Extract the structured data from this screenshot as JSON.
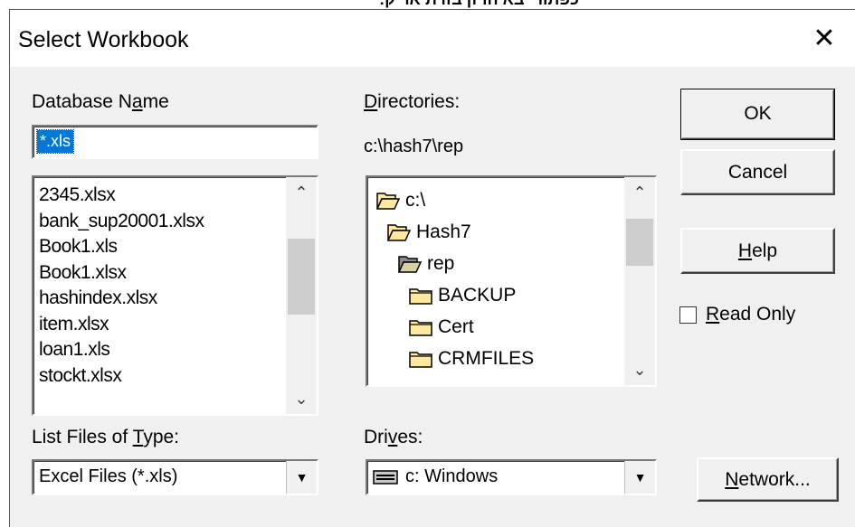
{
  "top_strip_text": "כפתור יבא הרזן בזרת אריק:",
  "dialog": {
    "title": "Select Workbook",
    "close_glyph": "✕"
  },
  "database_name": {
    "label_pre": "Database N",
    "label_u": "a",
    "label_post": "me",
    "value": "*.xls"
  },
  "files": [
    "2345.xlsx",
    "bank_sup20001.xlsx",
    "Book1.xls",
    "Book1.xlsx",
    "hashindex.xlsx",
    "item.xlsx",
    "loan1.xls",
    "stockt.xlsx"
  ],
  "directories": {
    "label_u": "D",
    "label_post": "irectories:",
    "current_path": "c:\\hash7\\rep",
    "items": [
      {
        "name": "c:\\",
        "icon": "open-folder-icon"
      },
      {
        "name": "Hash7",
        "icon": "open-folder-icon"
      },
      {
        "name": "rep",
        "icon": "open-folder-selected-icon"
      },
      {
        "name": "BACKUP",
        "icon": "folder-icon"
      },
      {
        "name": "Cert",
        "icon": "folder-icon"
      },
      {
        "name": "CRMFILES",
        "icon": "folder-icon"
      }
    ]
  },
  "buttons": {
    "ok": "OK",
    "cancel": "Cancel",
    "help_u": "H",
    "help_post": "elp",
    "network_u": "N",
    "network_post": "etwork..."
  },
  "read_only": {
    "label_u": "R",
    "label_post": "ead Only",
    "checked": false
  },
  "file_type": {
    "label_pre": "List Files of ",
    "label_u": "T",
    "label_post": "ype:",
    "value": "Excel Files (*.xls)"
  },
  "drives": {
    "label_pre": "Dri",
    "label_u": "v",
    "label_post": "es:",
    "value": "c: Windows",
    "icon": "drive-icon"
  },
  "scroll_up_glyph": "⌃",
  "scroll_down_glyph": "⌄",
  "dropdown_glyph": "▼",
  "colors": {
    "dialog_bg": "#f0f0f0",
    "selection": "#0078d7",
    "folder_yellow": "#ffe9a0"
  }
}
